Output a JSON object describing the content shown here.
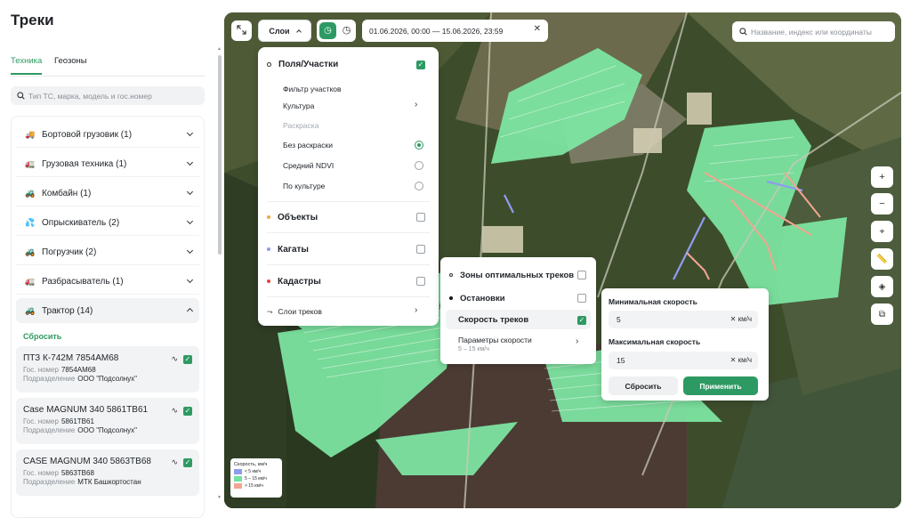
{
  "sidebar": {
    "title": "Треки",
    "tabs": [
      "Техника",
      "Геозоны"
    ],
    "search_placeholder": "Тип ТС, марка, модель и гос.номер",
    "categories": [
      {
        "icon": "🚚",
        "label": "Бортовой грузовик (1)"
      },
      {
        "icon": "🚛",
        "label": "Грузовая техника (1)"
      },
      {
        "icon": "🚜",
        "label": "Комбайн (1)"
      },
      {
        "icon": "💦",
        "label": "Опрыскиватель (2)"
      },
      {
        "icon": "🚜",
        "label": "Погрузчик (2)"
      },
      {
        "icon": "🚛",
        "label": "Разбрасыватель (1)"
      },
      {
        "icon": "🚜",
        "label": "Трактор (14)"
      }
    ],
    "reset_label": "Сбросить",
    "vehicles": [
      {
        "name": "ПТЗ К-742М 7854АМ68",
        "plate_label": "Гос. номер",
        "plate": "7854АМ68",
        "dept_label": "Подразделение",
        "dept": "ООО \"Подсолнух\""
      },
      {
        "name": "Case MAGNUM 340 5861ТВ61",
        "plate_label": "Гос. номер",
        "plate": "5861ТВ61",
        "dept_label": "Подразделение",
        "dept": "ООО \"Подсолнух\""
      },
      {
        "name": "CASE MAGNUM 340 5863ТВ68",
        "plate_label": "Гос. номер",
        "plate": "5863ТВ68",
        "dept_label": "Подразделение",
        "dept": "МТК Башкортостан"
      }
    ]
  },
  "map": {
    "layers_button": "Слои",
    "date_range": "01.06.2026, 00:00 — 15.06.2026, 23:59",
    "search_placeholder": "Название, индекс или координаты",
    "layers_menu": {
      "fields": "Поля/Участки",
      "filter": "Фильтр участков",
      "culture": "Культура",
      "coloring": "Раскраска",
      "no_coloring": "Без раскраски",
      "ndvi": "Средний NDVI",
      "by_culture": "По культуре",
      "objects": "Объекты",
      "kagaty": "Кагаты",
      "cadastre": "Кадастры",
      "track_layers": "Слои треков"
    },
    "tracks_menu": {
      "optimal": "Зоны оптимальных треков",
      "stops": "Остановки",
      "speed": "Скорость треков",
      "params": "Параметры скорости",
      "params_sub": "5 – 15 км/ч"
    },
    "speed_panel": {
      "min_label": "Минимальная скорость",
      "min_value": "5",
      "max_label": "Максимальная скорость",
      "max_value": "15",
      "unit": "км/ч",
      "reset": "Сбросить",
      "apply": "Применить"
    },
    "legend": {
      "title": "Скорость, км/ч",
      "items": [
        "< 5 км/ч",
        "5 – 15 км/ч",
        "> 15 км/ч"
      ],
      "colors": [
        "#8e9cf0",
        "#6fe3a0",
        "#f4a592"
      ]
    }
  },
  "colors": {
    "accent": "#2e9a63"
  }
}
